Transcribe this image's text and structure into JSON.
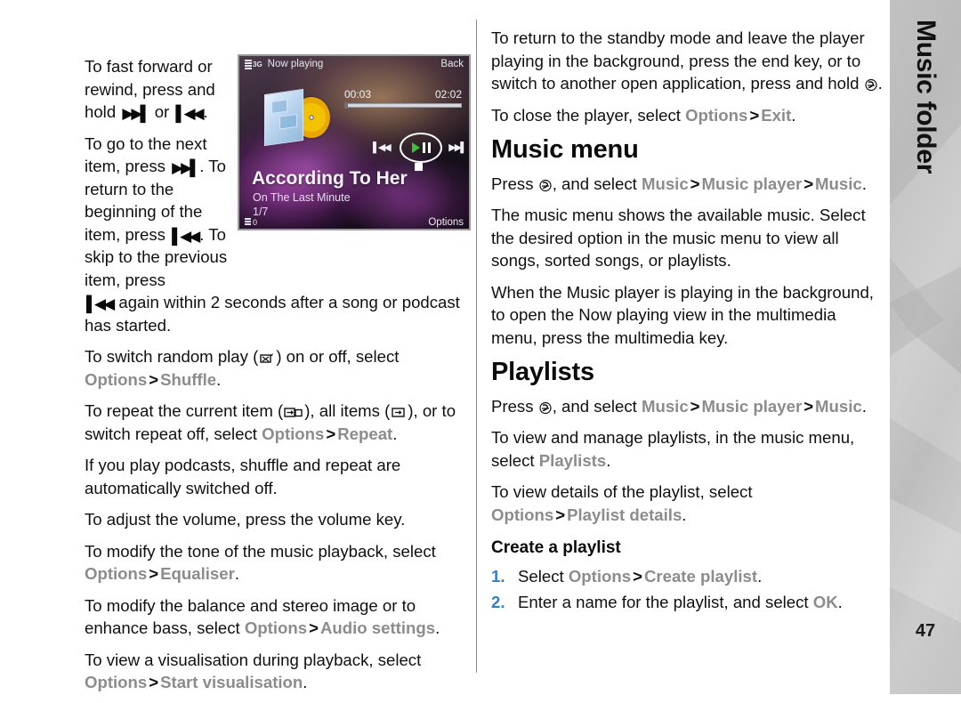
{
  "document": {
    "page_number": "47",
    "side_tab_label": "Music folder"
  },
  "left_column": {
    "p1_a": "To fast forward or rewind, press and hold ",
    "p1_or": " or ",
    "p1_end": ".",
    "p2_a": "To go to the next item, press ",
    "p2_b": ". To return to the beginning of the item, press ",
    "p2_c": ". To skip to the previous item, press ",
    "p2_d": " again within 2 seconds after a song or podcast has started.",
    "p3_a": "To switch random play (",
    "p3_b": ") on or off, select ",
    "p3_options": "Options",
    "p3_gt": ">",
    "p3_shuffle": "Shuffle",
    "p3_end": ".",
    "p4_a": "To repeat the current item (",
    "p4_b": "), all items (",
    "p4_c": "), or to switch repeat off, select ",
    "p4_options": "Options",
    "p4_gt": ">",
    "p4_repeat": "Repeat",
    "p4_end": ".",
    "p5": "If you play podcasts, shuffle and repeat are automatically switched off.",
    "p6": "To adjust the volume, press the volume key.",
    "p7_a": "To modify the tone of the music playback, select ",
    "p7_options": "Options",
    "p7_gt": ">",
    "p7_equaliser": "Equaliser",
    "p7_end": ".",
    "p8_a": "To modify the balance and stereo image or to enhance bass, select ",
    "p8_options": "Options",
    "p8_gt": ">",
    "p8_audio": "Audio settings",
    "p8_end": ".",
    "p9_a": "To view a visualisation during playback, select ",
    "p9_options": "Options",
    "p9_gt": ">",
    "p9_startvis": "Start visualisation",
    "p9_end": "."
  },
  "phone_screenshot": {
    "status_network": "3G",
    "status_title": "Now playing",
    "softkey_right_top": "Back",
    "elapsed_time": "00:03",
    "total_time": "02:02",
    "track_title": "According To Her",
    "track_album": "On The Last Minute",
    "track_index": "1/7",
    "volume_level": "0",
    "softkey_options": "Options"
  },
  "right_column": {
    "p1_a": "To return to the standby mode and leave the player playing in the background, press the end key, or to switch to another open application, press and hold ",
    "p1_end": ".",
    "p2_a": "To close the player, select ",
    "p2_options": "Options",
    "p2_gt": ">",
    "p2_exit": "Exit",
    "p2_end": ".",
    "h_music_menu": "Music menu",
    "p3_a": "Press ",
    "p3_b": ", and select ",
    "p3_music": "Music",
    "p3_gt1": ">",
    "p3_musicplayer": "Music player",
    "p3_gt2": ">",
    "p3_music2": "Music",
    "p3_end": ".",
    "p4": "The music menu shows the available music. Select the desired option in the music menu to view all songs, sorted songs, or playlists.",
    "p5": "When the Music player is playing in the background, to open the Now playing view in the multimedia menu, press the multimedia key.",
    "h_playlists": "Playlists",
    "p6_a": "Press ",
    "p6_b": ", and select ",
    "p6_music": "Music",
    "p6_gt1": ">",
    "p6_musicplayer": "Music player",
    "p6_gt2": ">",
    "p6_music2": "Music",
    "p6_end": ".",
    "p7_a": "To view and manage playlists, in the music menu, select ",
    "p7_playlists": "Playlists",
    "p7_end": ".",
    "p8_a": "To view details of the playlist, select ",
    "p8_options": "Options",
    "p8_gt": ">",
    "p8_details": "Playlist details",
    "p8_end": ".",
    "h_create_playlist": "Create a playlist",
    "step1_num": "1.",
    "step1_a": "Select ",
    "step1_options": "Options",
    "step1_gt": ">",
    "step1_create": "Create playlist",
    "step1_end": ".",
    "step2_num": "2.",
    "step2_a": "Enter a name for the playlist, and select ",
    "step2_ok": "OK",
    "step2_end": "."
  },
  "colors": {
    "ui_grey": "#8c8c8c",
    "step_number_blue": "#2f7fd1",
    "text_black": "#101010",
    "tab_grey": "#c4c4c4"
  }
}
